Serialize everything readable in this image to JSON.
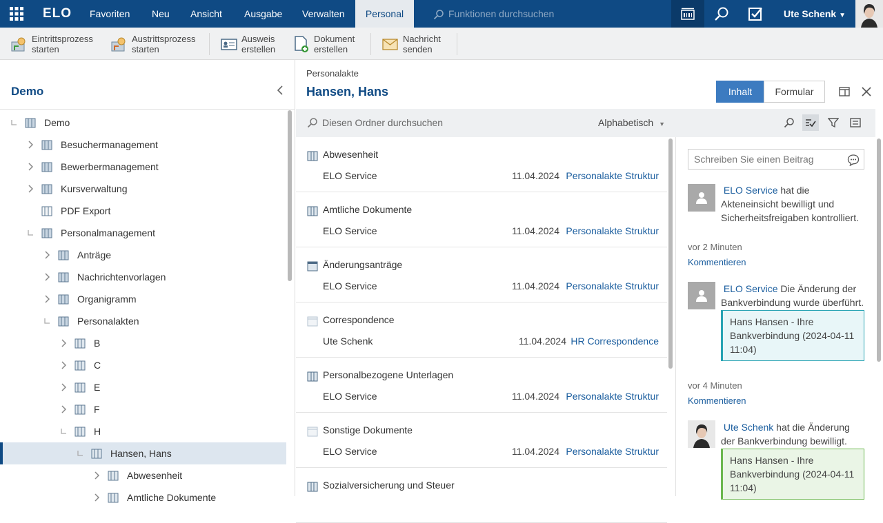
{
  "topbar": {
    "logo": "ELO",
    "menu": [
      "Favoriten",
      "Neu",
      "Ansicht",
      "Ausgabe",
      "Verwalten",
      "Personal"
    ],
    "active_menu": "Personal",
    "search_placeholder": "Funktionen durchsuchen",
    "user": "Ute Schenk"
  },
  "ribbon": {
    "buttons": [
      {
        "line1": "Eintrittsprozess",
        "line2": "starten"
      },
      {
        "line1": "Austrittsprozess",
        "line2": "starten"
      },
      {
        "line1": "Ausweis",
        "line2": "erstellen"
      },
      {
        "line1": "Dokument",
        "line2": "erstellen"
      },
      {
        "line1": "Nachricht",
        "line2": "senden"
      }
    ]
  },
  "tree": {
    "title": "Demo",
    "items": [
      {
        "label": "Demo",
        "toggle": "collapse",
        "level": 0
      },
      {
        "label": "Besuchermanagement",
        "toggle": "expand",
        "level": 1
      },
      {
        "label": "Bewerbermanagement",
        "toggle": "expand",
        "level": 1
      },
      {
        "label": "Kursverwaltung",
        "toggle": "expand",
        "level": 1
      },
      {
        "label": "PDF Export",
        "toggle": "none",
        "level": 1
      },
      {
        "label": "Personalmanagement",
        "toggle": "collapse",
        "level": 1
      },
      {
        "label": "Anträge",
        "toggle": "expand",
        "level": 2
      },
      {
        "label": "Nachrichtenvorlagen",
        "toggle": "expand",
        "level": 2
      },
      {
        "label": "Organigramm",
        "toggle": "expand",
        "level": 2
      },
      {
        "label": "Personalakten",
        "toggle": "collapse",
        "level": 2
      },
      {
        "label": "B",
        "toggle": "expand",
        "level": 3
      },
      {
        "label": "C",
        "toggle": "expand",
        "level": 3
      },
      {
        "label": "E",
        "toggle": "expand",
        "level": 3
      },
      {
        "label": "F",
        "toggle": "expand",
        "level": 3
      },
      {
        "label": "H",
        "toggle": "collapse",
        "level": 3
      },
      {
        "label": "Hansen, Hans",
        "toggle": "collapse",
        "level": 4,
        "selected": true
      },
      {
        "label": "Abwesenheit",
        "toggle": "expand",
        "level": 5
      },
      {
        "label": "Amtliche Dokumente",
        "toggle": "expand",
        "level": 5
      }
    ]
  },
  "content": {
    "breadcrumb": "Personalakte",
    "title": "Hansen, Hans",
    "tab_inhalt": "Inhalt",
    "tab_formular": "Formular",
    "search_placeholder": "Diesen Ordner durchsuchen",
    "sort_label": "Alphabetisch",
    "entries": [
      {
        "name": "Abwesenheit",
        "by": "ELO Service",
        "date": "11.04.2024",
        "mask": "Personalakte Struktur"
      },
      {
        "name": "Amtliche Dokumente",
        "by": "ELO Service",
        "date": "11.04.2024",
        "mask": "Personalakte Struktur"
      },
      {
        "name": "Änderungsanträge",
        "by": "ELO Service",
        "date": "11.04.2024",
        "mask": "Personalakte Struktur"
      },
      {
        "name": "Correspondence",
        "by": "Ute Schenk",
        "date": "11.04.2024",
        "mask": "HR Correspondence"
      },
      {
        "name": "Personalbezogene Unterlagen",
        "by": "ELO Service",
        "date": "11.04.2024",
        "mask": "Personalakte Struktur"
      },
      {
        "name": "Sonstige Dokumente",
        "by": "ELO Service",
        "date": "11.04.2024",
        "mask": "Personalakte Struktur"
      },
      {
        "name": "Sozialversicherung und Steuer",
        "by": "",
        "date": "",
        "mask": ""
      }
    ]
  },
  "feed": {
    "post_placeholder": "Schreiben Sie einen Beitrag",
    "comment_label": "Kommentieren",
    "posts": [
      {
        "author": "ELO Service",
        "text": "hat die Akteneinsicht bewilligt und Sicherheitsfreigaben kontrolliert.",
        "time": "vor 2 Minuten"
      },
      {
        "author": "ELO Service",
        "text": "Die Änderung der Bankverbindung wurde überführt.",
        "card": "Hans Hansen - Ihre Bankverbindung (2024-04-11 11:04)",
        "time": "vor 4 Minuten"
      },
      {
        "author": "Ute Schenk",
        "text": "hat die Änderung der Bankverbindung bewilligt.",
        "card": "Hans Hansen - Ihre Bankverbindung (2024-04-11 11:04)"
      }
    ]
  }
}
